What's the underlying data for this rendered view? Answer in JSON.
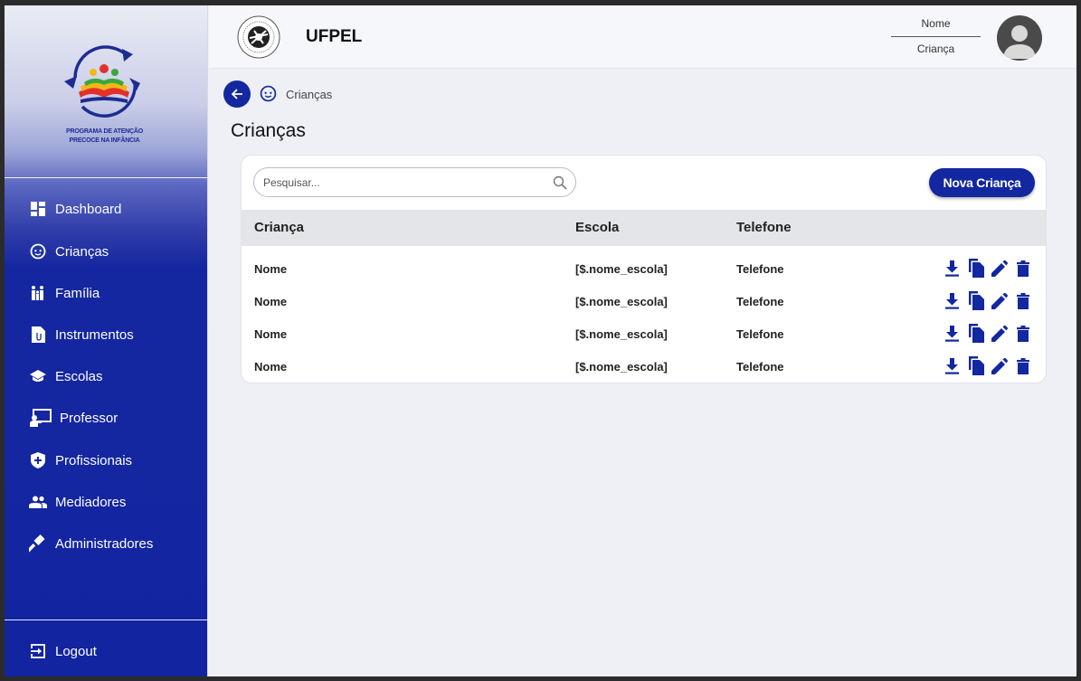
{
  "sidebar": {
    "logo_text_line1": "PROGRAMA DE ATENÇÃO",
    "logo_text_line2": "PRECOCE NA INFÂNCIA",
    "items": [
      {
        "label": "Dashboard",
        "icon": "dashboard-icon"
      },
      {
        "label": "Crianças",
        "icon": "child-face-icon"
      },
      {
        "label": "Família",
        "icon": "family-icon"
      },
      {
        "label": "Instrumentos",
        "icon": "document-icon"
      },
      {
        "label": "Escolas",
        "icon": "school-icon"
      },
      {
        "label": "Professor",
        "icon": "teacher-icon"
      },
      {
        "label": "Profissionais",
        "icon": "shield-plus-icon"
      },
      {
        "label": "Mediadores",
        "icon": "group-icon"
      },
      {
        "label": "Administradores",
        "icon": "gavel-icon"
      }
    ],
    "logout_label": "Logout"
  },
  "header": {
    "app_name": "UFPEL",
    "user_name": "Nome",
    "user_role": "Criança"
  },
  "breadcrumb": {
    "label": "Crianças"
  },
  "page": {
    "title": "Crianças"
  },
  "search": {
    "placeholder": "Pesquisar..."
  },
  "new_button_label": "Nova Criança",
  "table": {
    "headers": [
      "Criança",
      "Escola",
      "Telefone"
    ],
    "rows": [
      {
        "nome": "Nome",
        "escola": "[$.nome_escola]",
        "telefone": "Telefone"
      },
      {
        "nome": "Nome",
        "escola": "[$.nome_escola]",
        "telefone": "Telefone"
      },
      {
        "nome": "Nome",
        "escola": "[$.nome_escola]",
        "telefone": "Telefone"
      },
      {
        "nome": "Nome",
        "escola": "[$.nome_escola]",
        "telefone": "Telefone"
      }
    ],
    "row_actions": [
      "download-icon",
      "copy-icon",
      "edit-icon",
      "delete-icon"
    ]
  },
  "colors": {
    "primary": "#1227a0",
    "background": "#eef0f5",
    "table_header": "#e3e5e8"
  }
}
